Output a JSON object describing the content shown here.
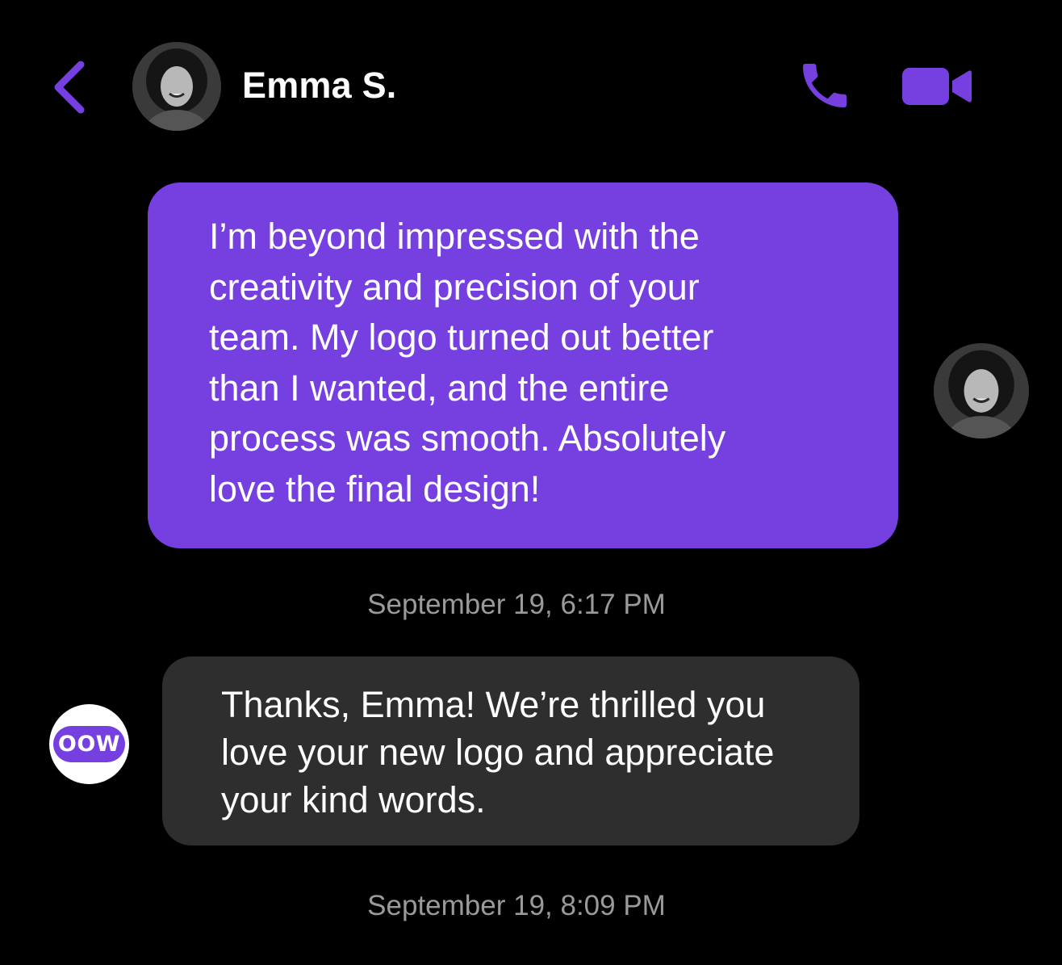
{
  "header": {
    "contact_name": "Emma S.",
    "back_icon": "chevron-left-icon",
    "call_icon": "phone-icon",
    "video_icon": "video-camera-icon"
  },
  "messages": [
    {
      "direction": "outgoing",
      "text": "I’m beyond impressed with the creativity and precision of your team. My logo turned out better than I wanted, and the entire process was smooth. Absolutely love the final design!",
      "lines": [
        "I’m beyond impressed with the",
        "creativity and precision of your",
        "team. My logo turned out better",
        "than I wanted, and the entire",
        "process was smooth. Absolutely",
        "love the final design!"
      ],
      "timestamp": "September 19, 6:17 PM"
    },
    {
      "direction": "incoming",
      "text": "Thanks, Emma! We’re thrilled you love your new logo and appreciate your kind words.",
      "lines": [
        "Thanks, Emma! We’re thrilled you",
        "love your new logo and appreciate",
        "your kind words."
      ],
      "sender_logo": "OOW",
      "timestamp": "September 19, 8:09 PM"
    }
  ],
  "colors": {
    "background": "#000000",
    "accent": "#7540df",
    "incoming_bubble": "#2e2e2e",
    "timestamp": "#9a9a9a",
    "text": "#ffffff"
  }
}
